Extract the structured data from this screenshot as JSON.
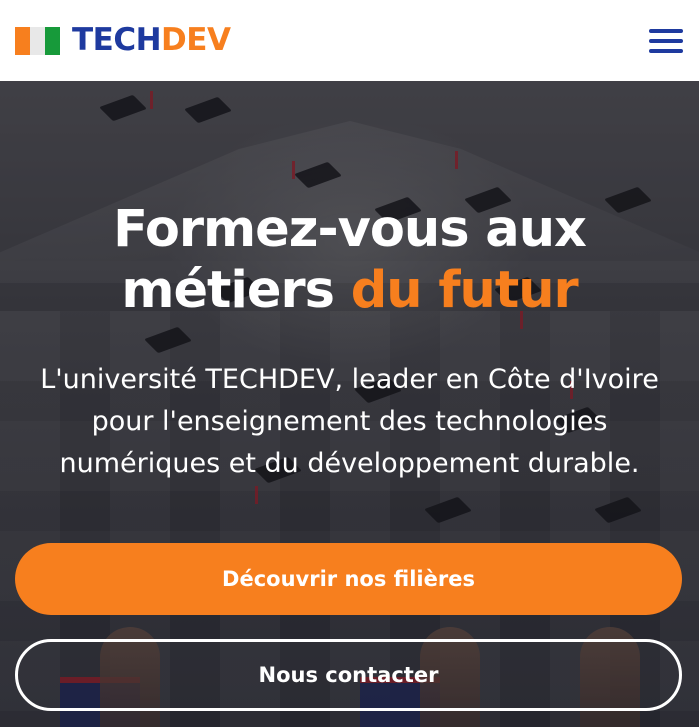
{
  "header": {
    "logo_tech": "TECH",
    "logo_dev": "DEV",
    "flag_colors": [
      "#f77f1e",
      "#e8e8e8",
      "#179a3a"
    ],
    "menu_icon": "hamburger-menu-icon"
  },
  "hero": {
    "title_line1": "Formez-vous aux",
    "title_line2_plain": "métiers ",
    "title_line2_accent": "du futur",
    "description": "L'université TECHDEV, leader en Côte d'Ivoire pour l'enseignement des technologies numériques et du développement durable.",
    "primary_button": "Découvrir nos filières",
    "secondary_button": "Nous contacter"
  },
  "colors": {
    "brand_blue": "#1e3a9f",
    "brand_orange": "#f77f1e",
    "text_light": "#ffffff"
  }
}
